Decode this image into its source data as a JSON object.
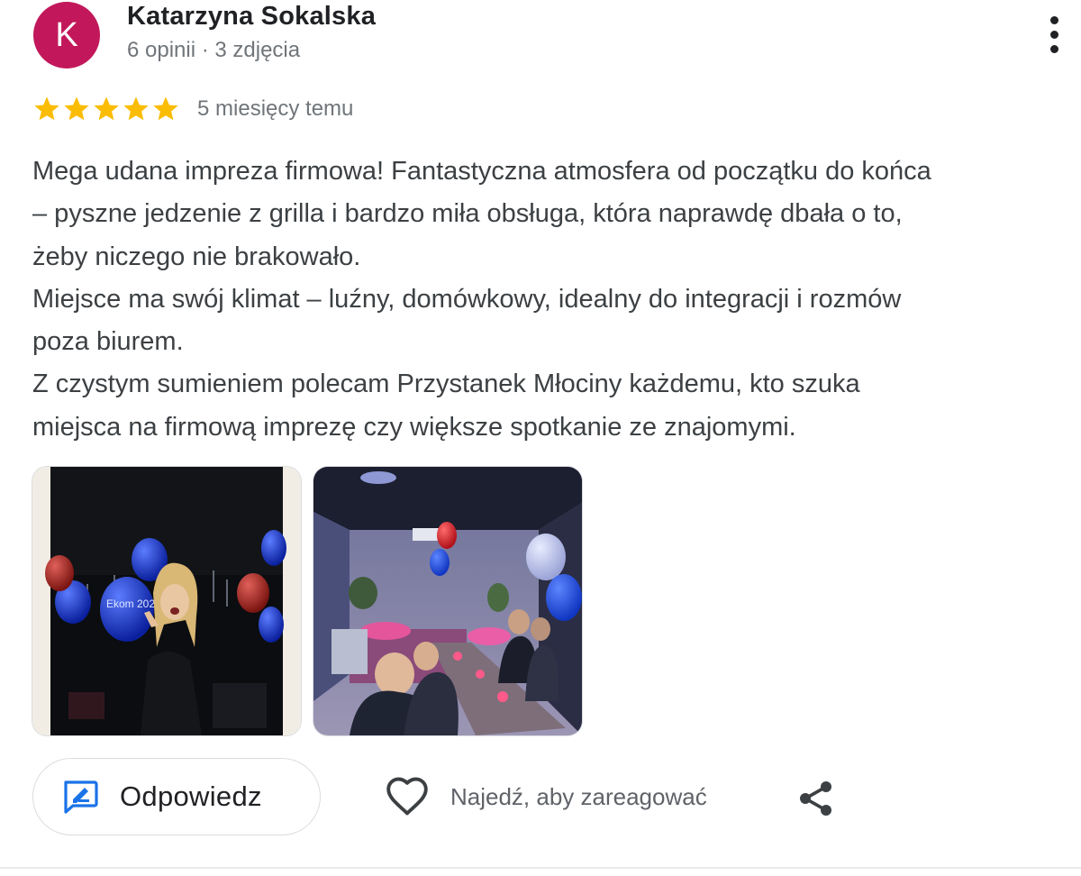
{
  "author": {
    "initial": "K",
    "name": "Katarzyna Sokalska",
    "meta": "6 opinii · 3 zdjęcia",
    "avatar_color": "#c2185b"
  },
  "review": {
    "rating": 5,
    "rating_max": 5,
    "star_color": "#fbbc04",
    "time_ago": "5 miesięcy temu",
    "text_lines": [
      "Mega udana impreza firmowa! Fantastyczna atmosfera od początku do końca",
      "– pyszne jedzenie z grilla i bardzo miła obsługa, która naprawdę dbała o to,",
      "żeby niczego nie brakowało.",
      "Miejsce ma swój klimat – luźny, domówkowy, idealny do integracji i rozmów",
      "poza biurem.",
      "Z czystym sumieniem polecam Przystanek Młociny każdemu, kto szuka",
      "miejsca na firmową imprezę czy większe spotkanie ze znajomymi."
    ],
    "photos": [
      {
        "icon": "photo-party-balloons",
        "balloon_text": "Ekom 2025"
      },
      {
        "icon": "photo-restaurant-interior"
      }
    ]
  },
  "actions": {
    "reply_label": "Odpowiedz",
    "react_label": "Najedź, aby zareagować",
    "reply_icon_color": "#1a73e8",
    "icons": [
      "more-vert-icon",
      "reply-icon",
      "heart-icon",
      "share-icon"
    ]
  }
}
